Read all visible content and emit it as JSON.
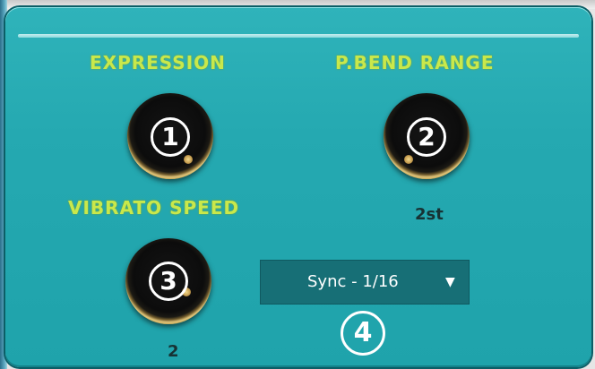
{
  "controls": {
    "expression": {
      "label": "EXPRESSION",
      "badge": "1"
    },
    "pbend_range": {
      "label": "P.BEND RANGE",
      "badge": "2",
      "value": "2st"
    },
    "vibrato_speed": {
      "label": "VIBRATO SPEED",
      "badge": "3",
      "value": "2"
    },
    "sync": {
      "selected": "Sync - 1/16",
      "arrow": "▼",
      "badge": "4"
    }
  },
  "colors": {
    "panel": "#25a9b1",
    "label": "#c9e84b",
    "dropdown_bg": "#176f76",
    "value_text": "#173234"
  },
  "icons": {
    "dropdown_arrow": "chevron-down-icon",
    "knob": "knob-icon"
  }
}
